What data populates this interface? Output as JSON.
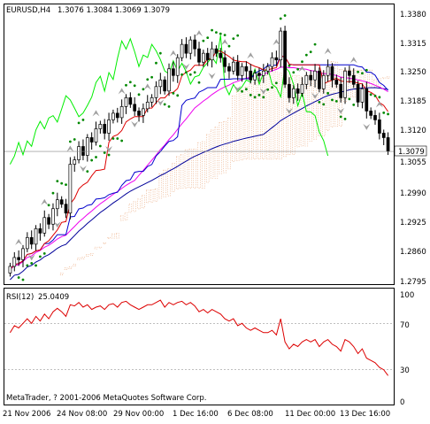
{
  "chart_header": {
    "symbol_tf": "EURUSD,H4",
    "ohlc": "1.3076 1.3084 1.3069 1.3079"
  },
  "rsi_header": {
    "label": "RSI(12)",
    "value": "25.0409"
  },
  "copyright": "MetaTrader, ? 2001-2006 MetaQuotes Software Corp.",
  "price_axis": {
    "ticks": [
      "1.3380",
      "1.3315",
      "1.3250",
      "1.3185",
      "1.3120",
      "1.3055",
      "1.2990",
      "1.2925",
      "1.2860",
      "1.2795"
    ],
    "current_price": "1.3079"
  },
  "rsi_axis": {
    "ticks": [
      "100",
      "70",
      "30",
      "0"
    ]
  },
  "time_axis": {
    "ticks": [
      "21 Nov 2006",
      "24 Nov 08:00",
      "29 Nov 00:00",
      "1 Dec 16:00",
      "6 Dec 08:00",
      "11 Dec 00:00",
      "13 Dec 16:00"
    ]
  },
  "colors": {
    "candle": "#000000",
    "ichimoku_green": "#00ee00",
    "kijun_blue": "#0000cc",
    "tenkan_red": "#dd0000",
    "ma_magenta": "#ee00ee",
    "ma_navy": "#000099",
    "sar_green": "#008800",
    "fractal_gray": "#a0a0a0",
    "cloud": "#e8a070",
    "rsi_red": "#dd0000"
  },
  "chart_data": {
    "type": "candlestick",
    "ylim": [
      1.278,
      1.341
    ],
    "rsi_ylim": [
      0,
      100
    ],
    "rsi_levels": [
      70,
      30
    ],
    "close": [
      1.282,
      1.284,
      1.2835,
      1.286,
      1.2885,
      1.287,
      1.2905,
      1.2895,
      1.293,
      1.2915,
      1.295,
      1.297,
      1.296,
      1.294,
      1.305,
      1.306,
      1.309,
      1.307,
      1.311,
      1.31,
      1.313,
      1.314,
      1.312,
      1.315,
      1.3165,
      1.3155,
      1.318,
      1.32,
      1.3185,
      1.317,
      1.316,
      1.3175,
      1.319,
      1.32,
      1.3225,
      1.324,
      1.3215,
      1.3265,
      1.325,
      1.329,
      1.332,
      1.33,
      1.333,
      1.331,
      1.328,
      1.33,
      1.3285,
      1.331,
      1.33,
      1.329,
      1.327,
      1.326,
      1.328,
      1.325,
      1.327,
      1.326,
      1.324,
      1.3255,
      1.325,
      1.326,
      1.327,
      1.329,
      1.3285,
      1.335,
      1.323,
      1.32,
      1.322,
      1.321,
      1.323,
      1.325,
      1.324,
      1.326,
      1.322,
      1.325,
      1.327,
      1.324,
      1.323,
      1.32,
      1.326,
      1.325,
      1.323,
      1.319,
      1.322,
      1.317,
      1.316,
      1.315,
      1.312,
      1.311,
      1.3079
    ],
    "rsi": [
      62,
      68,
      66,
      70,
      74,
      70,
      76,
      72,
      78,
      74,
      80,
      83,
      80,
      76,
      86,
      85,
      88,
      84,
      86,
      82,
      84,
      85,
      82,
      86,
      87,
      84,
      88,
      89,
      86,
      84,
      82,
      84,
      86,
      86,
      88,
      90,
      84,
      88,
      86,
      88,
      89,
      86,
      88,
      85,
      80,
      82,
      79,
      82,
      80,
      78,
      74,
      72,
      74,
      68,
      70,
      66,
      64,
      66,
      64,
      62,
      62,
      64,
      60,
      74,
      54,
      48,
      52,
      50,
      54,
      56,
      54,
      56,
      50,
      54,
      56,
      52,
      50,
      46,
      56,
      54,
      50,
      44,
      48,
      40,
      38,
      36,
      32,
      30,
      25
    ]
  }
}
